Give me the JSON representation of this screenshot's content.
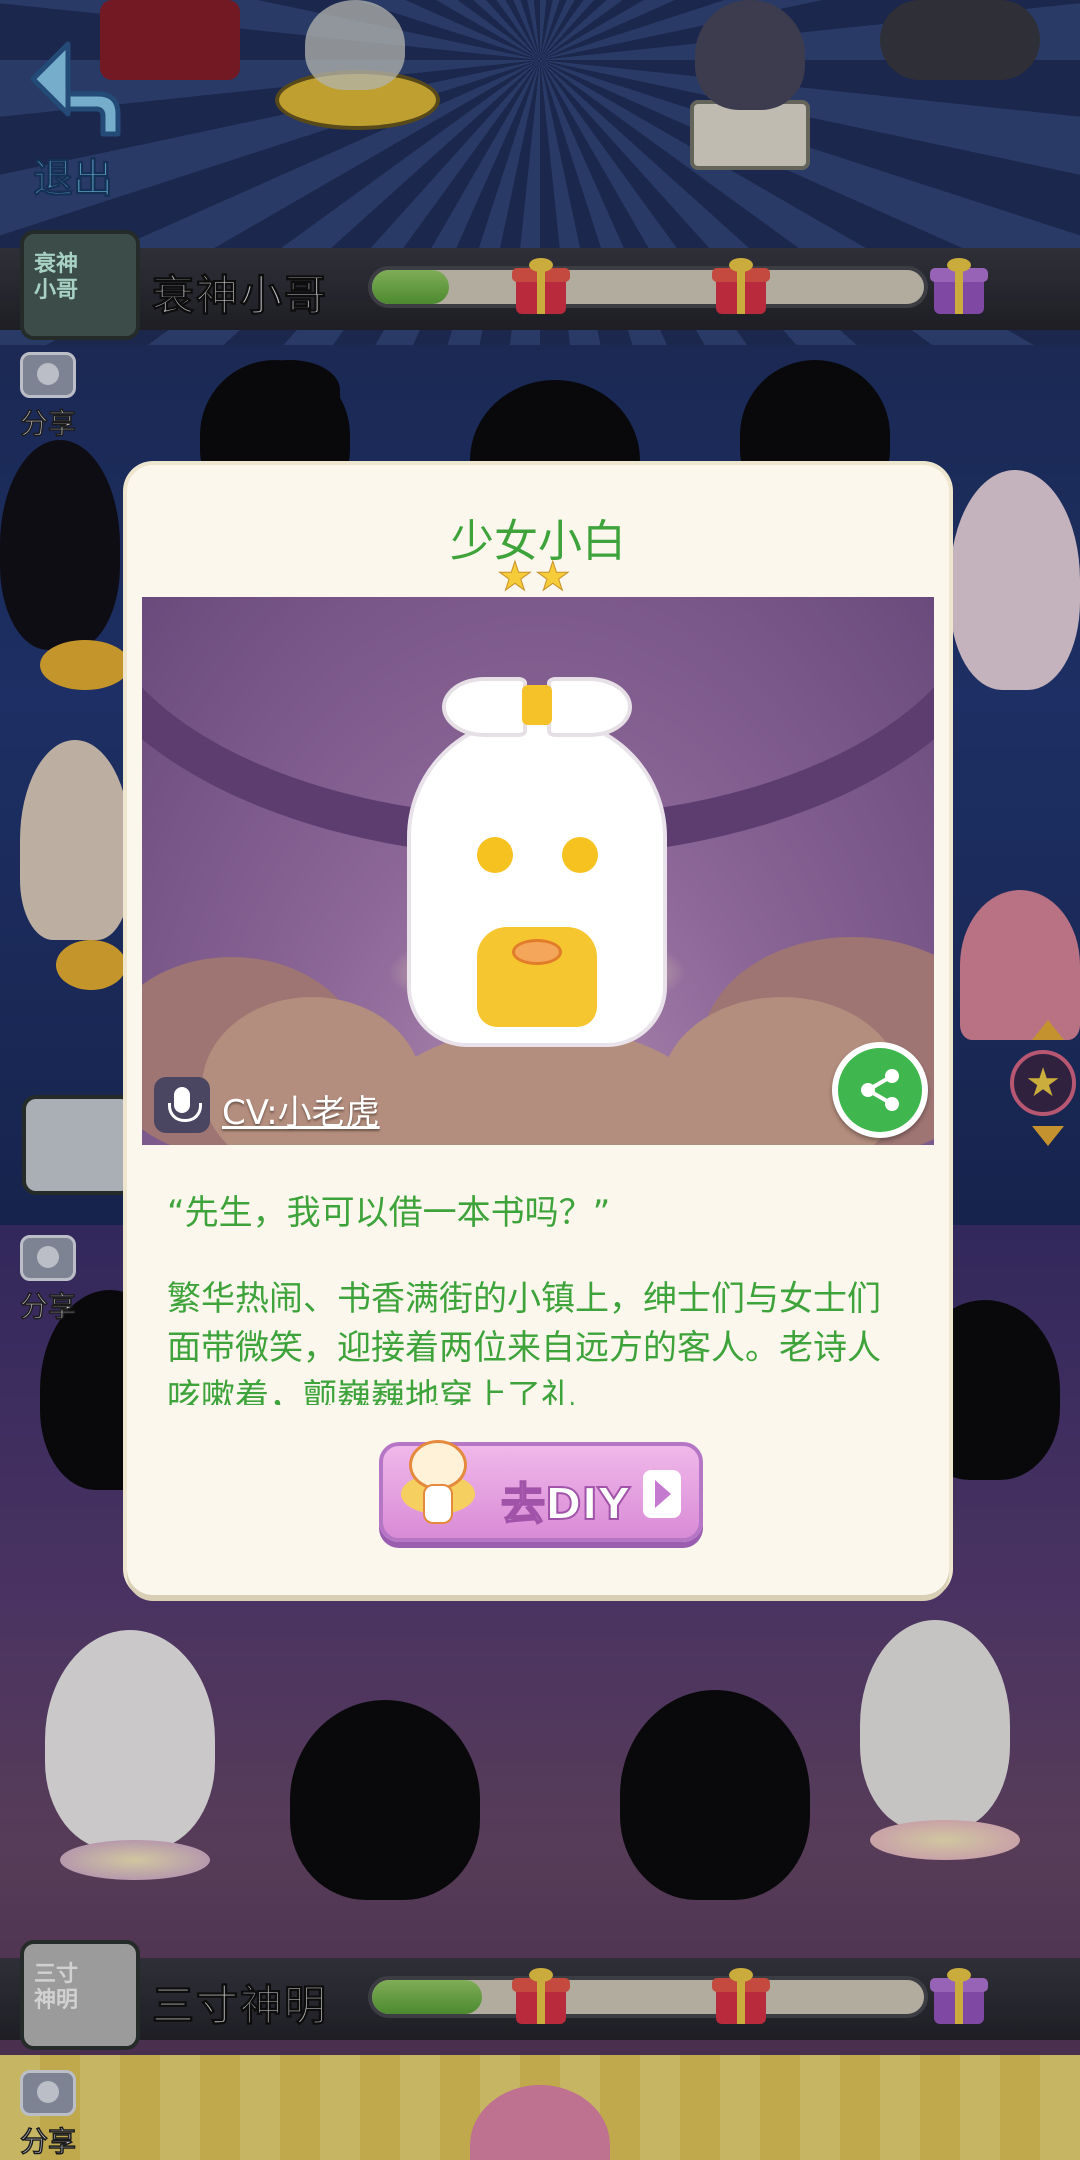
{
  "nav": {
    "exit_label": "退出"
  },
  "rows": [
    {
      "avatar_text": "衰神\n小哥",
      "name": "衰神小哥",
      "progress": 0.14
    },
    {
      "avatar_text": "三寸\n神明",
      "name": "三寸神明",
      "progress": 0.2
    }
  ],
  "side": {
    "share_label": "分享"
  },
  "modal": {
    "title": "少女小白",
    "stars": 2,
    "cv_label": "CV:小老虎",
    "quote": "“先生，我可以借一本书吗？”",
    "description": "繁华热闹、书香满街的小镇上，绅士们与女士们面带微笑，迎接着两位来自远方的客人。老诗人咳嗽着，颤巍巍地穿上了礼",
    "diy_label": "去DIY"
  },
  "icons": {
    "exit": "back-arrow-icon",
    "share": "camera-icon",
    "gift": "gift-box-icon",
    "mic": "microphone-icon",
    "share_modal": "share-icon",
    "star": "star-icon"
  },
  "colors": {
    "title_green": "#3ea33a",
    "progress_fill": "#5ea83b",
    "diy_pink": "#d98bd6",
    "share_green": "#3fb64e",
    "star_gold": "#f6cc3a"
  }
}
